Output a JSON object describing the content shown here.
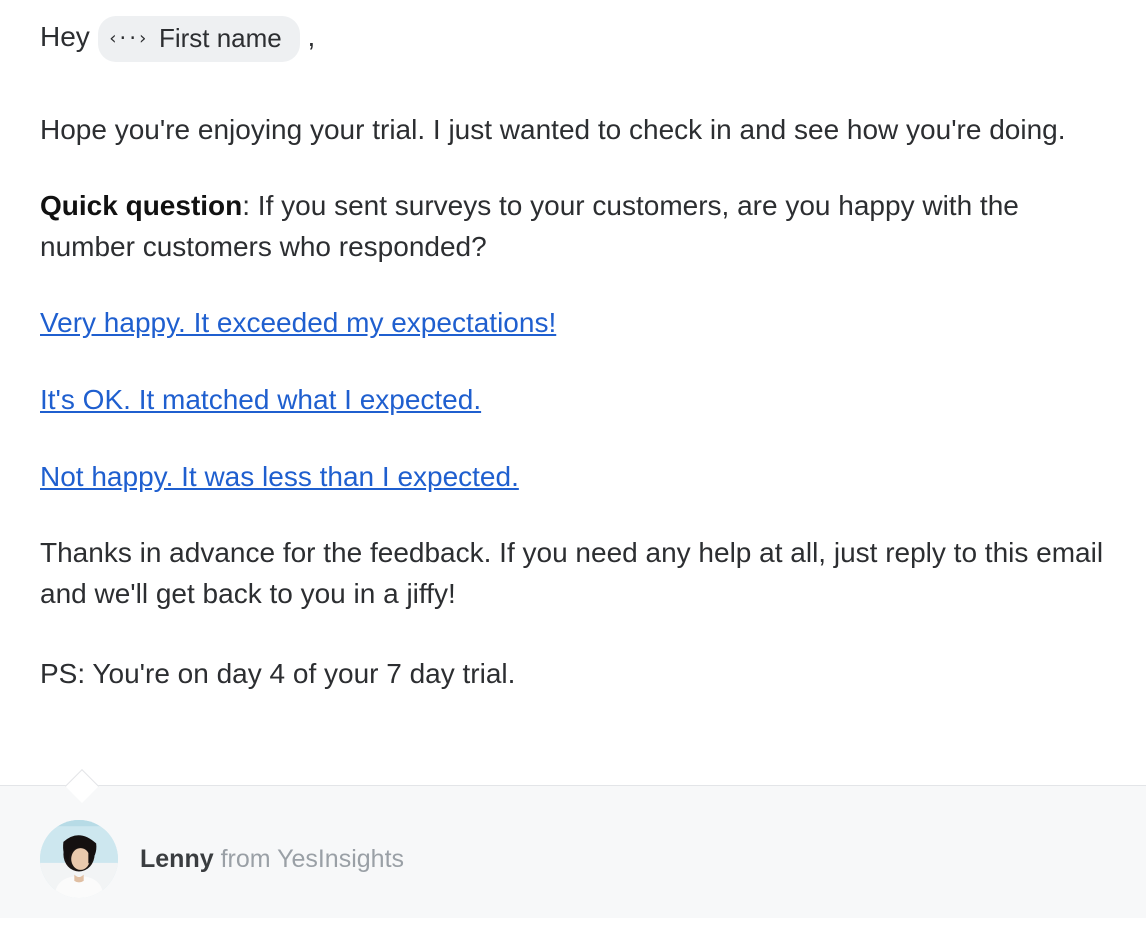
{
  "greeting": {
    "prefix": "Hey",
    "merge_tag_label": "First name",
    "suffix": ","
  },
  "intro": "Hope you're enjoying your trial. I just wanted to check in and see how you're doing.",
  "question": {
    "lead": "Quick question",
    "rest": ": If you sent surveys to your customers, are you happy with the number customers who responded?"
  },
  "answers": [
    "Very happy. It exceeded my expectations!",
    "It's OK. It matched what I expected.",
    "Not happy. It was less than I expected."
  ],
  "thanks": "Thanks in advance for the feedback. If you need any help at all, just reply to this email and we'll get back to you in a jiffy!",
  "ps": "PS: You're on day 4 of your 7 day trial.",
  "sender": {
    "name": "Lenny",
    "from_word": "from",
    "company": "YesInsights"
  }
}
